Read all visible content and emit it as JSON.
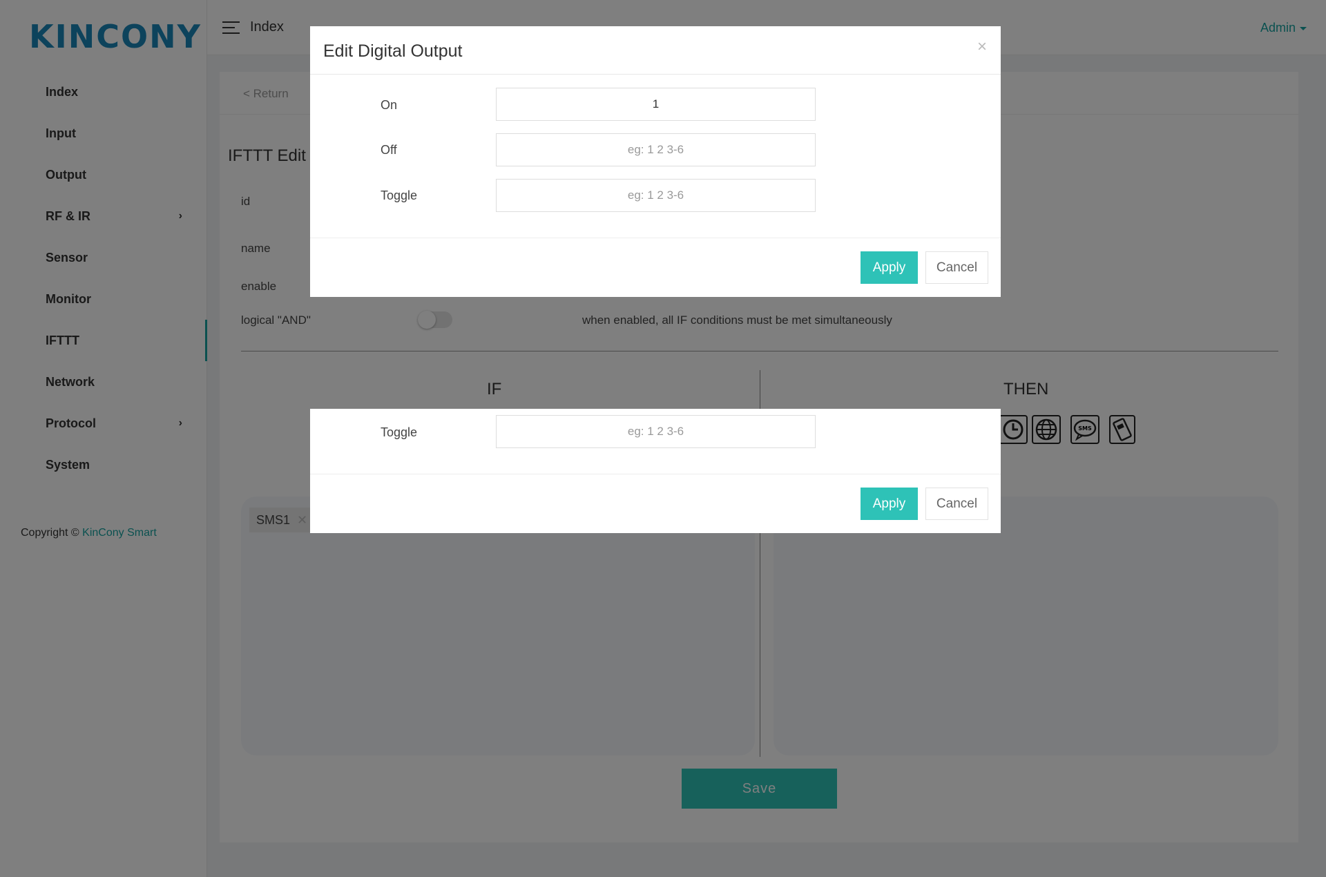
{
  "brand": {
    "logo_text": "KINCONY"
  },
  "sidebar": {
    "items": [
      {
        "label": "Index"
      },
      {
        "label": "Input"
      },
      {
        "label": "Output"
      },
      {
        "label": "RF & IR"
      },
      {
        "label": "Sensor"
      },
      {
        "label": "Monitor"
      },
      {
        "label": "IFTTT"
      },
      {
        "label": "Network"
      },
      {
        "label": "Protocol"
      },
      {
        "label": "System"
      }
    ],
    "copyright_prefix": "Copyright ©",
    "copyright_brand": "KinCony Smart"
  },
  "header": {
    "breadcrumb": "Index",
    "user": "Admin"
  },
  "main": {
    "return_label": "< Return",
    "title": "IFTTT Edit",
    "fields": {
      "id": "id",
      "name": "name",
      "enable": "enable",
      "logical_and": "logical \"AND\""
    },
    "logical_and_hint": "when enabled, all IF conditions must be met simultaneously",
    "if_heading": "IF",
    "then_heading": "THEN",
    "if_chip": "SMS1",
    "save_label": "Save"
  },
  "modal_main": {
    "title": "Edit Digital Output",
    "close_symbol": "×",
    "on_label": "On",
    "on_value": "1",
    "off_label": "Off",
    "off_placeholder": "eg: 1 2 3-6",
    "toggle_label": "Toggle",
    "toggle_placeholder": "eg: 1 2 3-6",
    "apply_label": "Apply",
    "cancel_label": "Cancel"
  },
  "modal_second": {
    "toggle_label": "Toggle",
    "toggle_placeholder": "eg: 1 2 3-6",
    "apply_label": "Apply",
    "cancel_label": "Cancel"
  },
  "icons": [
    "clock-icon",
    "globe-icon",
    "sms-icon",
    "phone-icon"
  ],
  "colors": {
    "accent": "#2ec2b7",
    "brand": "#1a86b8"
  }
}
